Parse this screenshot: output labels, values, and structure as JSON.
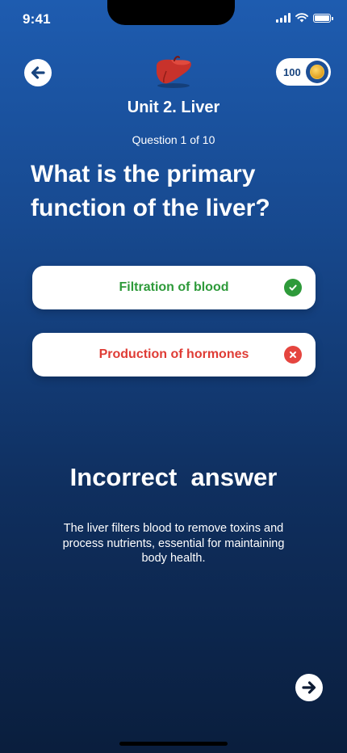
{
  "status_bar": {
    "time": "9:41"
  },
  "header": {
    "unit_title": "Unit 2. Liver",
    "organ_icon": "liver-icon",
    "coins": {
      "count": "100",
      "icon": "coin-icon"
    }
  },
  "quiz": {
    "progress": "Question 1 of 10",
    "question": "What is the primary function of the liver?",
    "answers": [
      {
        "label": "Filtration of blood",
        "state": "correct",
        "icon": "check-icon",
        "color": "#2e9a3a"
      },
      {
        "label": "Production of hormones",
        "state": "incorrect",
        "icon": "close-icon",
        "color": "#df3c35"
      }
    ]
  },
  "result": {
    "title": "Incorrect  answer",
    "explanation": "The liver filters blood to remove toxins and process nutrients, essential for maintaining body health."
  },
  "colors": {
    "background_top": "#1e5cb0",
    "background_bottom": "#0a1e3d",
    "correct": "#2e9a3a",
    "incorrect": "#df3c35"
  }
}
